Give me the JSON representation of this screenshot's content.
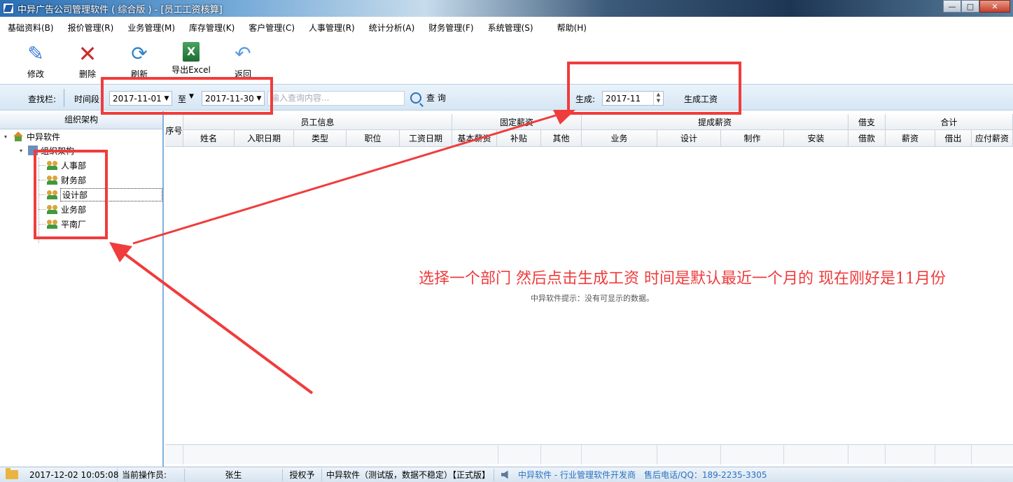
{
  "window": {
    "title": "中异广告公司管理软件 ( 综合版 )  - [员工工资核算]",
    "buttons": {
      "minimize": "—",
      "maximize": "□",
      "close": "✕"
    }
  },
  "menu": [
    "基础资料(B)",
    "报价管理(R)",
    "业务管理(M)",
    "库存管理(K)",
    "客户管理(C)",
    "人事管理(R)",
    "统计分析(A)",
    "财务管理(F)",
    "系统管理(S)",
    "帮助(H)"
  ],
  "toolbar": {
    "edit": "修改",
    "delete": "删除",
    "refresh": "刷新",
    "export": "导出Excel",
    "back": "返回"
  },
  "search": {
    "label": "查找栏:",
    "time_label": "时间段",
    "date_from": "2017-11-01",
    "to_label": "至",
    "date_to": "2017-11-30",
    "placeholder": "输入查询内容...",
    "search_button": "查 询",
    "generate_label": "生成:",
    "generate_month": "2017-11",
    "generate_button": "生成工资"
  },
  "tree": {
    "header": "组织架构",
    "root": "中异软件",
    "org": "组织架构",
    "departments": [
      "人事部",
      "财务部",
      "设计部",
      "业务部",
      "平南厂"
    ],
    "selected": "设计部"
  },
  "grid": {
    "seq": "序号",
    "groups": [
      "员工信息",
      "固定薪资",
      "提成薪资",
      "借支",
      "合计"
    ],
    "columns": [
      "姓名",
      "入职日期",
      "类型",
      "职位",
      "工资日期",
      "基本薪资",
      "补贴",
      "其他",
      "业务",
      "设计",
      "制作",
      "安装",
      "借款",
      "薪资",
      "借出",
      "应付薪资"
    ],
    "empty_message": "中异软件提示：没有可显示的数据。"
  },
  "annotation": "选择一个部门 然后点击生成工资 时间是默认最近一个月的 现在刚好是11月份",
  "status": {
    "datetime": "2017-12-02 10:05:08",
    "operator_label": "当前操作员:",
    "operator": "张生",
    "auth": "授权予",
    "version": "中异软件（测试版，数据不稳定）【正式版】",
    "vendor": "中异软件 - 行业管理软件开发商",
    "contact": "售后电话/QQ：189-2235-3305"
  },
  "colors": {
    "highlight": "#f03c3c",
    "accent": "#2a72c0"
  }
}
